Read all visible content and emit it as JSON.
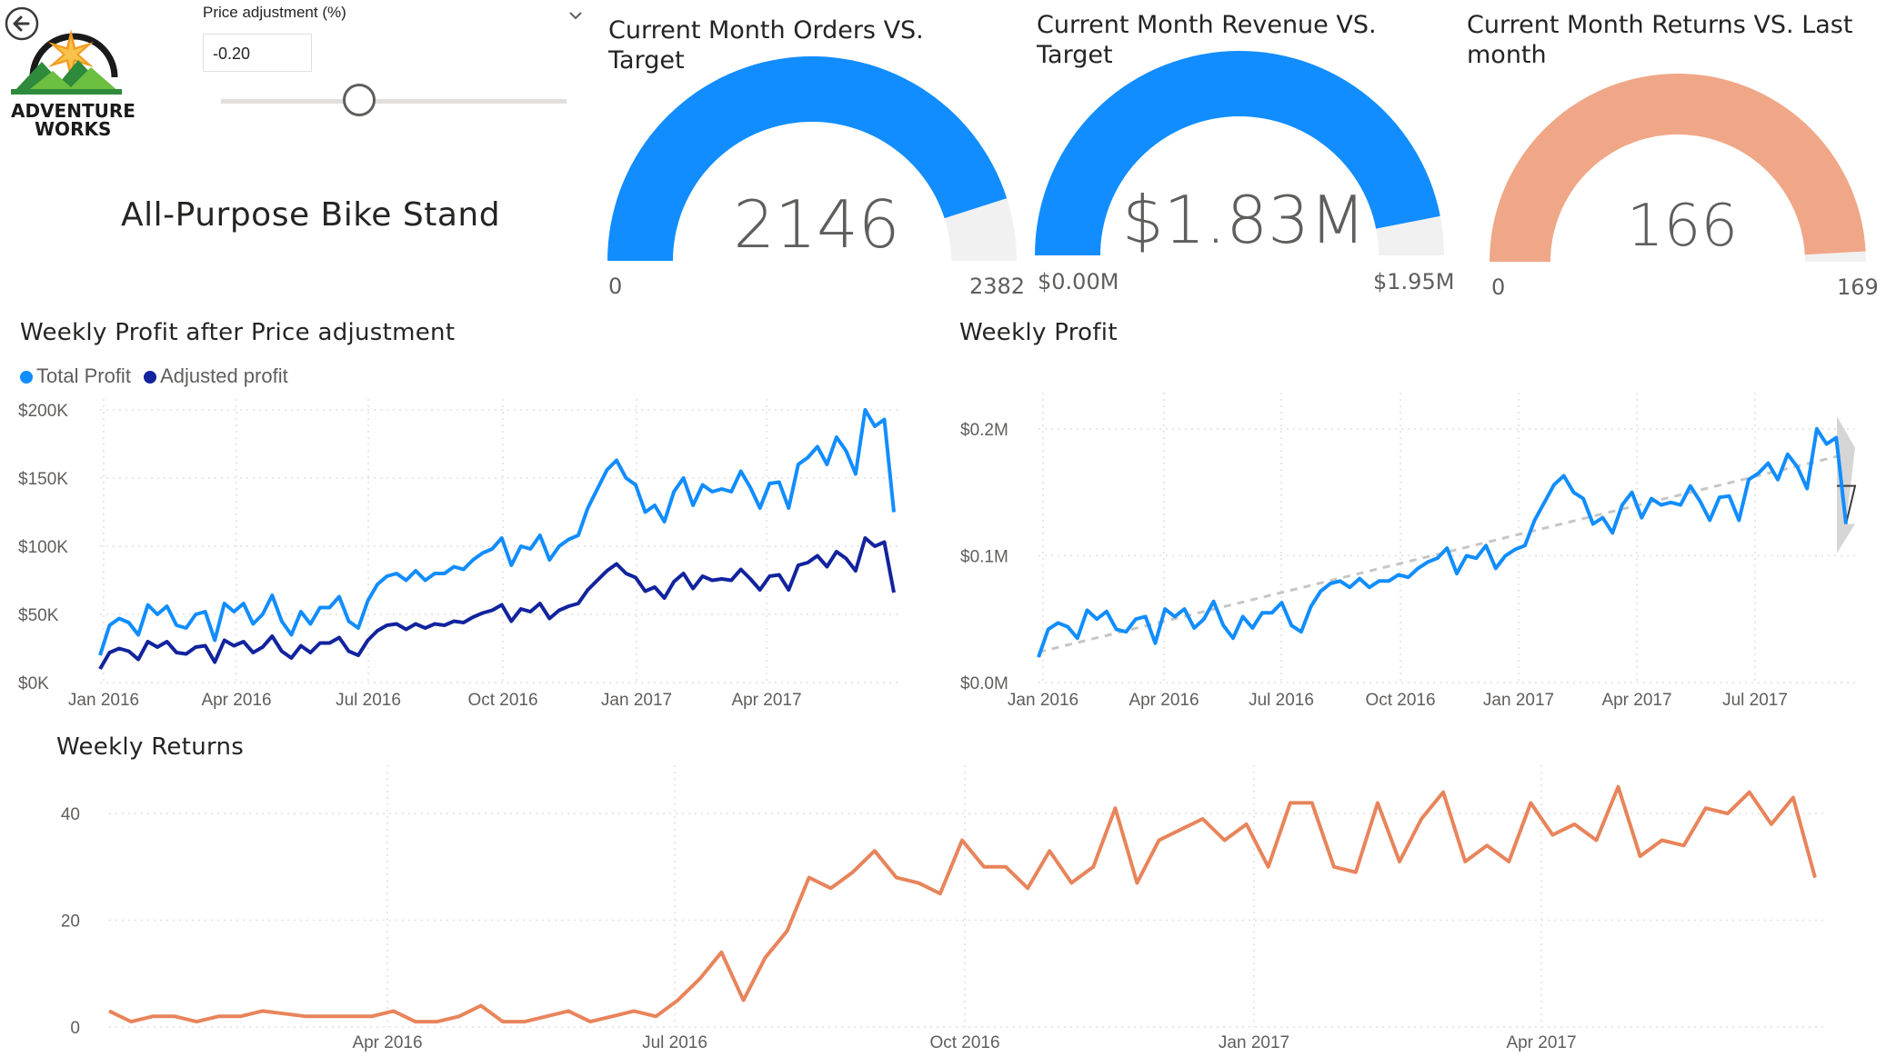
{
  "logo": {
    "line1": "ADVENTURE",
    "line2": "WORKS"
  },
  "back_icon": "back-arrow-icon",
  "slicer": {
    "label": "Price adjustment (%)",
    "value": "-0.20",
    "chevron_icon": "chevron-down-icon",
    "level_fraction": 0.4
  },
  "product_title": "All-Purpose Bike Stand",
  "gauges": [
    {
      "title": "Current Month Orders VS. Target",
      "value_text": "2146",
      "min_text": "0",
      "max_text": "2382",
      "value": 2146,
      "min": 0,
      "max": 2382,
      "color": "#118dff"
    },
    {
      "title": "Current Month Revenue VS. Target",
      "value_text": "$1.83M",
      "min_text": "$0.00M",
      "max_text": "$1.95M",
      "value": 1.83,
      "min": 0,
      "max": 1.95,
      "color": "#118dff"
    },
    {
      "title": "Current Month Returns VS. Last month",
      "value_text": "166",
      "min_text": "0",
      "max_text": "169",
      "value": 166,
      "min": 0,
      "max": 169,
      "color": "#f0a787"
    }
  ],
  "colors": {
    "total_profit": "#118dff",
    "adjusted_profit": "#12239e",
    "returns": "#e8845b",
    "gauge_track": "#f1f1f1",
    "forecast_band": "#d0d0d0"
  },
  "chart_data": [
    {
      "type": "line",
      "title": "Weekly Profit after Price adjustment",
      "x_start": "2016-01-03",
      "x_step_days": 7,
      "x_ticks": [
        "Jan 2016",
        "Apr 2016",
        "Jul 2016",
        "Oct 2016",
        "Jan 2017",
        "Apr 2017"
      ],
      "y_ticks": [
        "$0K",
        "$50K",
        "$100K",
        "$150K",
        "$200K"
      ],
      "ylim": [
        0,
        200000
      ],
      "legend": "top-left",
      "grid": true,
      "series": [
        {
          "name": "Total Profit",
          "color": "#118dff",
          "values": [
            20000,
            42000,
            47000,
            44000,
            35000,
            57000,
            50000,
            56000,
            42000,
            40000,
            50000,
            52000,
            31000,
            58000,
            52000,
            58000,
            43000,
            50000,
            64000,
            45000,
            35000,
            52000,
            43000,
            55000,
            55000,
            63000,
            45000,
            40000,
            60000,
            72000,
            78000,
            80000,
            75000,
            82000,
            75000,
            80000,
            80000,
            85000,
            83000,
            90000,
            95000,
            98000,
            106000,
            86000,
            100000,
            98000,
            108000,
            90000,
            100000,
            105000,
            108000,
            128000,
            142000,
            156000,
            163000,
            150000,
            145000,
            125000,
            130000,
            118000,
            140000,
            150000,
            130000,
            145000,
            140000,
            142000,
            140000,
            155000,
            143000,
            128000,
            146000,
            147000,
            128000,
            160000,
            165000,
            173000,
            160000,
            180000,
            170000,
            153000,
            200000,
            188000,
            193000,
            125000
          ]
        },
        {
          "name": "Adjusted profit",
          "color": "#12239e",
          "values": [
            10000,
            22000,
            25000,
            23000,
            17000,
            30000,
            26000,
            30000,
            22000,
            21000,
            26000,
            27000,
            15000,
            31000,
            27000,
            30000,
            22000,
            26000,
            34000,
            23000,
            18000,
            27000,
            22000,
            29000,
            29000,
            33000,
            23000,
            20000,
            31000,
            38000,
            42000,
            43000,
            39000,
            43000,
            40000,
            43000,
            42000,
            45000,
            44000,
            48000,
            51000,
            53000,
            57000,
            45000,
            54000,
            52000,
            58000,
            47000,
            53000,
            56000,
            58000,
            68000,
            75000,
            82000,
            87000,
            80000,
            77000,
            67000,
            70000,
            62000,
            74000,
            80000,
            69000,
            78000,
            75000,
            76000,
            75000,
            83000,
            76000,
            68000,
            78000,
            79000,
            68000,
            86000,
            88000,
            93000,
            85000,
            96000,
            91000,
            82000,
            106000,
            100000,
            103000,
            66000
          ]
        }
      ]
    },
    {
      "type": "line",
      "title": "Weekly Profit",
      "x_start": "2016-01-03",
      "x_step_days": 7,
      "x_ticks": [
        "Jan 2016",
        "Apr 2016",
        "Jul 2016",
        "Oct 2016",
        "Jan 2017",
        "Apr 2017",
        "Jul 2017"
      ],
      "y_ticks": [
        "$0.0M",
        "$0.1M",
        "$0.2M"
      ],
      "ylim": [
        0,
        0.23
      ],
      "grid": true,
      "series": [
        {
          "name": "Weekly Profit",
          "color": "#118dff",
          "values": [
            0.02,
            0.042,
            0.047,
            0.044,
            0.035,
            0.057,
            0.05,
            0.056,
            0.042,
            0.04,
            0.05,
            0.052,
            0.031,
            0.058,
            0.052,
            0.058,
            0.043,
            0.05,
            0.064,
            0.045,
            0.035,
            0.052,
            0.043,
            0.055,
            0.055,
            0.063,
            0.045,
            0.04,
            0.06,
            0.072,
            0.078,
            0.08,
            0.075,
            0.082,
            0.075,
            0.08,
            0.08,
            0.085,
            0.083,
            0.09,
            0.095,
            0.098,
            0.106,
            0.086,
            0.1,
            0.098,
            0.108,
            0.09,
            0.1,
            0.105,
            0.108,
            0.128,
            0.142,
            0.156,
            0.163,
            0.15,
            0.145,
            0.125,
            0.13,
            0.118,
            0.14,
            0.15,
            0.13,
            0.145,
            0.14,
            0.142,
            0.14,
            0.155,
            0.143,
            0.128,
            0.146,
            0.147,
            0.128,
            0.16,
            0.165,
            0.173,
            0.16,
            0.18,
            0.17,
            0.153,
            0.2,
            0.188,
            0.193,
            0.125
          ]
        }
      ],
      "trend_line": {
        "start": 0.024,
        "end": 0.18
      },
      "forecast": {
        "weeks": 10,
        "value": 0.155,
        "upper_end": 0.21,
        "lower_end": 0.102
      }
    },
    {
      "type": "line",
      "title": "Weekly Returns",
      "x_start": "2016-01-03",
      "x_step_days": 7,
      "x_ticks": [
        "Apr 2016",
        "Jul 2016",
        "Oct 2016",
        "Jan 2017",
        "Apr 2017"
      ],
      "y_ticks": [
        "0",
        "20",
        "40"
      ],
      "ylim": [
        0,
        47
      ],
      "grid": true,
      "series": [
        {
          "name": "Weekly Returns",
          "color": "#e8845b",
          "values": [
            3,
            1,
            2,
            2,
            1,
            2,
            2,
            3,
            2.5,
            2,
            2,
            2,
            2,
            3,
            1,
            1,
            2,
            4,
            1,
            1,
            2,
            3,
            1,
            2,
            3,
            2,
            5,
            9,
            14,
            5,
            13,
            18,
            28,
            26,
            29,
            33,
            28,
            27,
            25,
            35,
            30,
            30,
            26,
            33,
            27,
            30,
            41,
            27,
            35,
            37,
            39,
            35,
            38,
            30,
            42,
            42,
            30,
            29,
            42,
            31,
            39,
            44,
            31,
            34,
            31,
            42,
            36,
            38,
            35,
            45,
            32,
            35,
            34,
            41,
            40,
            44,
            38,
            43,
            28
          ]
        }
      ]
    }
  ]
}
